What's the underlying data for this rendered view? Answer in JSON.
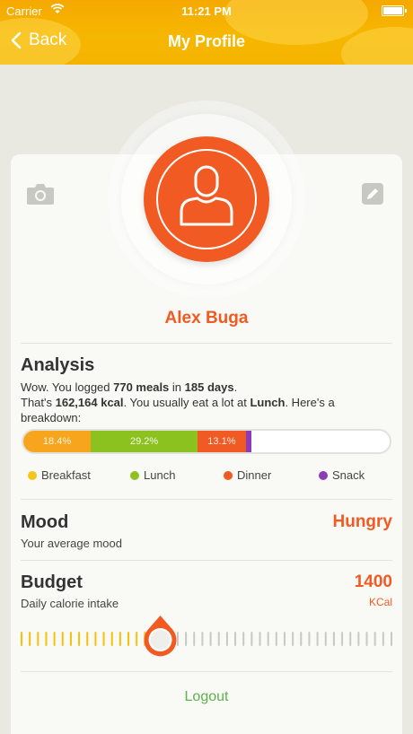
{
  "status_bar": {
    "carrier": "Carrier",
    "time": "11:21 PM"
  },
  "nav": {
    "back_label": "Back",
    "title": "My Profile"
  },
  "profile": {
    "name": "Alex Buga"
  },
  "analysis": {
    "heading": "Analysis",
    "line1_a": "Wow. You logged ",
    "meals": "770 meals",
    "line1_b": " in ",
    "days": "185 days",
    "line1_c": ".",
    "line2_a": "That's ",
    "kcal": "162,164 kcal",
    "line2_b": ". You usually eat a lot at ",
    "top_meal": "Lunch",
    "line2_c": ". Here's a breakdown:",
    "breakdown": [
      {
        "name": "Breakfast",
        "percent": 18.4,
        "label": "18.4%",
        "color": "#f7a51c"
      },
      {
        "name": "Lunch",
        "percent": 29.2,
        "label": "29.2%",
        "color": "#8cc21f"
      },
      {
        "name": "Dinner",
        "percent": 13.1,
        "label": "13.1%",
        "color": "#f15a22"
      },
      {
        "name": "Snack",
        "percent": 1.5,
        "label": "",
        "color": "#8e3bb8"
      }
    ],
    "legend": [
      {
        "name": "Breakfast",
        "color": "#f5c518"
      },
      {
        "name": "Lunch",
        "color": "#8cc21f"
      },
      {
        "name": "Dinner",
        "color": "#f15a22"
      },
      {
        "name": "Snack",
        "color": "#8e3bb8"
      }
    ]
  },
  "mood": {
    "heading": "Mood",
    "value": "Hungry",
    "caption": "Your average mood"
  },
  "budget": {
    "heading": "Budget",
    "value": "1400",
    "unit": "KCal",
    "caption": "Daily calorie intake",
    "slider_fraction": 0.37
  },
  "logout_label": "Logout",
  "colors": {
    "accent": "#f15a22",
    "header": "#f6b300",
    "logout": "#5bb34a"
  }
}
